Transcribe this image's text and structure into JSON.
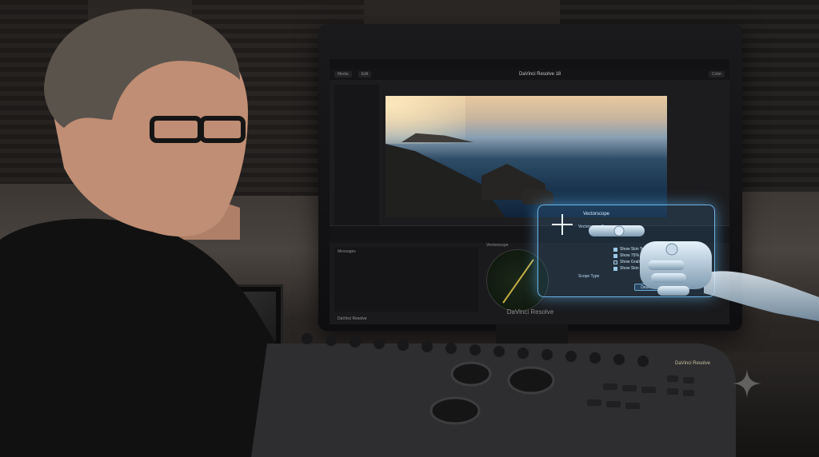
{
  "monitor": {
    "app_title": "DaVinci Resolve 18",
    "ribbon_buttons": [
      "Media",
      "Edit",
      "Color"
    ],
    "brand_label": "DaVinci Resolve",
    "lower_left_label": "Messages",
    "scope_label": "Vectorscope",
    "status_text": "DaVinci Resolve"
  },
  "overlay": {
    "title": "Vectorscope",
    "section": "Vectorscope Scope",
    "options": [
      {
        "label": "Show Skin Tone",
        "checked": true
      },
      {
        "label": "Show 75% Box",
        "checked": true
      },
      {
        "label": "Show Graticule",
        "checked": false
      },
      {
        "label": "Show Skin Tone Indicator",
        "checked": true
      }
    ],
    "field_label": "Scope Type",
    "button_label": "Deselect"
  },
  "console": {
    "brand": "DaVinci Resolve"
  },
  "colors": {
    "overlay_accent": "#78c8ff",
    "vectorscope_trace": "#c7b144"
  }
}
